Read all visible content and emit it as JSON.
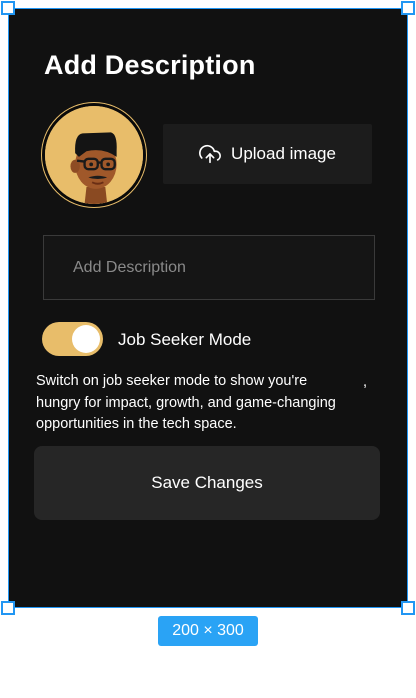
{
  "dialog": {
    "title": "Add Description",
    "upload_label": "Upload image",
    "description_placeholder": "Add Description",
    "description_value": "",
    "toggle": {
      "label": "Job Seeker Mode",
      "on": true
    },
    "help_lines": [
      "Switch on job seeker mode to show you're",
      "hungry for impact, growth, and game-changing",
      "opportunities in the tech space."
    ],
    "stray_mark": ",",
    "save_label": "Save Changes"
  },
  "canvas": {
    "size_badge": "200 × 300"
  },
  "icons": {
    "upload": "upload-icon",
    "avatar": "memoji-avatar"
  },
  "colors": {
    "background": "#111111",
    "accent": "#e8bd6a",
    "selection": "#2196f3"
  }
}
